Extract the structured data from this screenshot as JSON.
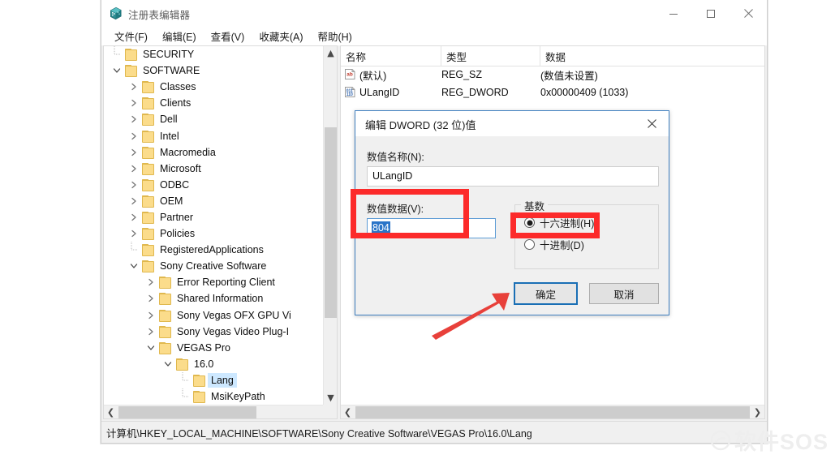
{
  "window": {
    "title": "注册表编辑器",
    "app_icon": "registry-icon",
    "controls": {
      "minimize": "minimize-icon",
      "maximize": "maximize-icon",
      "close": "close-icon"
    }
  },
  "menubar": {
    "items": [
      {
        "label": "文件(F)"
      },
      {
        "label": "编辑(E)"
      },
      {
        "label": "查看(V)"
      },
      {
        "label": "收藏夹(A)"
      },
      {
        "label": "帮助(H)"
      }
    ]
  },
  "tree": {
    "items": [
      {
        "label": "SECURITY",
        "depth": 1,
        "twist": "none",
        "selected": false
      },
      {
        "label": "SOFTWARE",
        "depth": 1,
        "twist": "expanded",
        "selected": false
      },
      {
        "label": "Classes",
        "depth": 2,
        "twist": "collapsed",
        "selected": false
      },
      {
        "label": "Clients",
        "depth": 2,
        "twist": "collapsed",
        "selected": false
      },
      {
        "label": "Dell",
        "depth": 2,
        "twist": "collapsed",
        "selected": false
      },
      {
        "label": "Intel",
        "depth": 2,
        "twist": "collapsed",
        "selected": false
      },
      {
        "label": "Macromedia",
        "depth": 2,
        "twist": "collapsed",
        "selected": false
      },
      {
        "label": "Microsoft",
        "depth": 2,
        "twist": "collapsed",
        "selected": false
      },
      {
        "label": "ODBC",
        "depth": 2,
        "twist": "collapsed",
        "selected": false
      },
      {
        "label": "OEM",
        "depth": 2,
        "twist": "collapsed",
        "selected": false
      },
      {
        "label": "Partner",
        "depth": 2,
        "twist": "collapsed",
        "selected": false
      },
      {
        "label": "Policies",
        "depth": 2,
        "twist": "collapsed",
        "selected": false
      },
      {
        "label": "RegisteredApplications",
        "depth": 2,
        "twist": "none",
        "selected": false
      },
      {
        "label": "Sony Creative Software",
        "depth": 2,
        "twist": "expanded",
        "selected": false
      },
      {
        "label": "Error Reporting Client",
        "depth": 3,
        "twist": "collapsed",
        "selected": false
      },
      {
        "label": "Shared Information",
        "depth": 3,
        "twist": "collapsed",
        "selected": false
      },
      {
        "label": "Sony Vegas OFX GPU Vi",
        "depth": 3,
        "twist": "collapsed",
        "selected": false
      },
      {
        "label": "Sony Vegas Video Plug-I",
        "depth": 3,
        "twist": "collapsed",
        "selected": false
      },
      {
        "label": "VEGAS Pro",
        "depth": 3,
        "twist": "expanded",
        "selected": false
      },
      {
        "label": "16.0",
        "depth": 4,
        "twist": "expanded",
        "selected": false
      },
      {
        "label": "Lang",
        "depth": 5,
        "twist": "none",
        "selected": true
      },
      {
        "label": "MsiKeyPath",
        "depth": 5,
        "twist": "none",
        "selected": false
      }
    ]
  },
  "listview": {
    "columns": [
      {
        "label": "名称"
      },
      {
        "label": "类型"
      },
      {
        "label": "数据"
      }
    ],
    "rows": [
      {
        "icon": "string-value-icon",
        "name": "(默认)",
        "type": "REG_SZ",
        "data": "(数值未设置)"
      },
      {
        "icon": "dword-value-icon",
        "name": "ULangID",
        "type": "REG_DWORD",
        "data": "0x00000409 (1033)"
      }
    ]
  },
  "dialog": {
    "title": "编辑 DWORD (32 位)值",
    "close_icon": "close-icon",
    "name_label": "数值名称(N):",
    "name_value": "ULangID",
    "data_label": "数值数据(V):",
    "data_value": "804",
    "group_title": "基数",
    "radios": [
      {
        "label": "十六进制(H)",
        "selected": true
      },
      {
        "label": "十进制(D)",
        "selected": false
      }
    ],
    "ok_label": "确定",
    "cancel_label": "取消"
  },
  "statusbar": {
    "path": "计算机\\HKEY_LOCAL_MACHINE\\SOFTWARE\\Sony Creative Software\\VEGAS Pro\\16.0\\Lang"
  },
  "watermark": {
    "text": "软件SOS"
  },
  "colors": {
    "annotation_red": "#fc2a2a",
    "focus_blue": "#1a6fb5",
    "selection_blue": "#2a74c8",
    "tree_selection": "#cde8ff",
    "folder_yellow": "#fbdc8b"
  }
}
